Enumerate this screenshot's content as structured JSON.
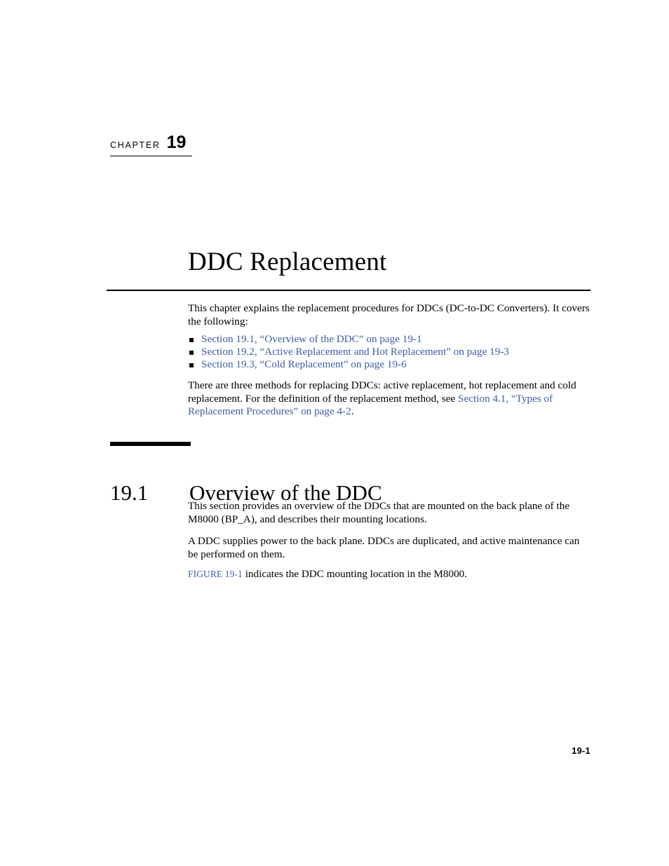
{
  "chapter": {
    "label": "CHAPTER",
    "number": "19",
    "title": "DDC Replacement"
  },
  "intro": {
    "paragraph": "This chapter explains the replacement procedures for DDCs (DC-to-DC Converters). It covers the following:",
    "toc_items": [
      "Section 19.1, “Overview of the DDC” on page 19-1",
      "Section 19.2, “Active Replacement and Hot Replacement” on page 19-3",
      "Section 19.3, “Cold Replacement” on page 19-6"
    ],
    "methods_text_before": "There are three methods for replacing DDCs: active replacement, hot replacement and cold replacement. For the definition of the replacement method, see ",
    "methods_link": "Section 4.1, “Types of Replacement Procedures” on page 4-2",
    "methods_text_after": "."
  },
  "section": {
    "number": "19.1",
    "title": "Overview of the DDC",
    "paragraph_1": "This section provides an overview of the DDCs that are mounted on the back plane of the M8000 (BP_A), and describes their mounting locations.",
    "paragraph_2": "A DDC supplies power to the back plane. DDCs are duplicated, and active maintenance can be performed on them.",
    "figure_ref": "FIGURE 19-1",
    "paragraph_3_after": " indicates the DDC mounting location in the M8000."
  },
  "footer": {
    "page_number": "19-1"
  },
  "colors": {
    "link": "#3c5ea8",
    "text": "#000000",
    "background": "#ffffff"
  }
}
